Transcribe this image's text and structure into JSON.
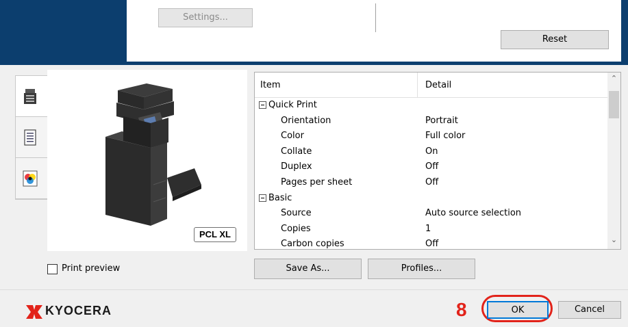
{
  "toolbar": {
    "settings_label": "Settings...",
    "reset_label": "Reset"
  },
  "side_tabs": [
    {
      "icon": "printer-icon"
    },
    {
      "icon": "document-icon"
    },
    {
      "icon": "color-icon"
    }
  ],
  "preview": {
    "pdl_badge": "PCL XL"
  },
  "details": {
    "columns": {
      "item": "Item",
      "detail": "Detail"
    },
    "rows": [
      {
        "label": "Quick Print",
        "detail": "",
        "group": true
      },
      {
        "label": "Orientation",
        "detail": "Portrait"
      },
      {
        "label": "Color",
        "detail": "Full color"
      },
      {
        "label": "Collate",
        "detail": "On"
      },
      {
        "label": "Duplex",
        "detail": "Off"
      },
      {
        "label": "Pages per sheet",
        "detail": "Off"
      },
      {
        "label": "Basic",
        "detail": "",
        "group": true
      },
      {
        "label": "Source",
        "detail": "Auto source selection"
      },
      {
        "label": "Copies",
        "detail": "1"
      },
      {
        "label": "Carbon copies",
        "detail": "Off"
      }
    ]
  },
  "print_preview": {
    "label": "Print preview",
    "checked": false
  },
  "actions": {
    "save_as_label": "Save As...",
    "profiles_label": "Profiles...",
    "ok_label": "OK",
    "cancel_label": "Cancel"
  },
  "brand": {
    "name": "KYOCERA",
    "color": "#e2231a"
  },
  "annotation": {
    "step_number": "8",
    "color": "#e2231a"
  },
  "colors": {
    "accent_blue": "#0c3e6e",
    "focus_blue": "#0078d7"
  }
}
